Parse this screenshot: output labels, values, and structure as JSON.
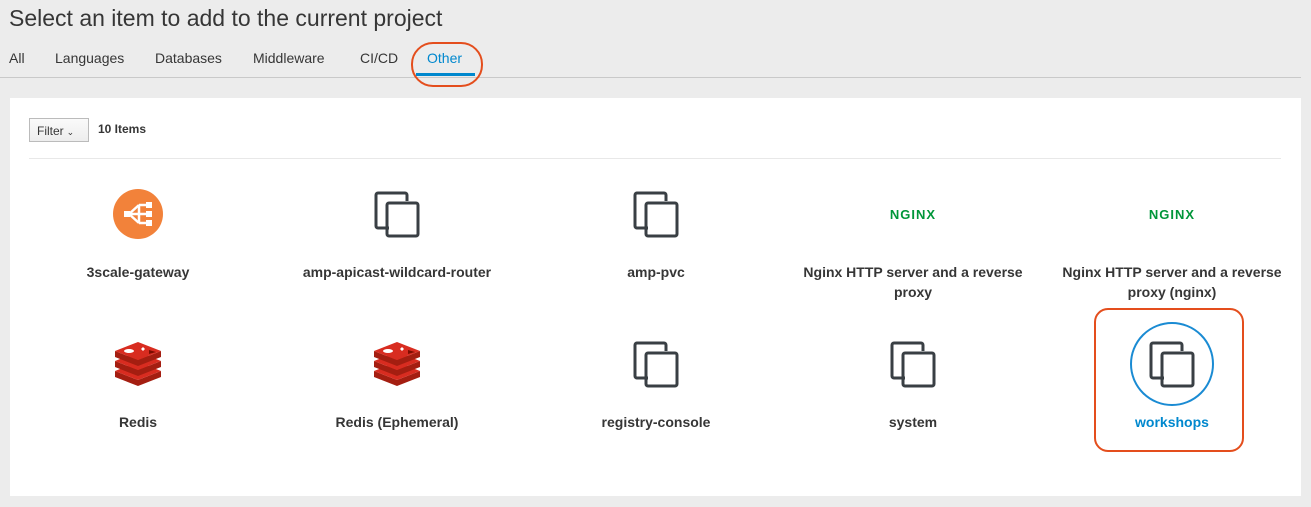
{
  "page": {
    "title": "Select an item to add to the current project"
  },
  "tabs": [
    {
      "label": "All"
    },
    {
      "label": "Languages"
    },
    {
      "label": "Databases"
    },
    {
      "label": "Middleware"
    },
    {
      "label": "CI/CD"
    },
    {
      "label": "Other"
    }
  ],
  "toolbar": {
    "filter_label": "Filter",
    "count": "10 Items"
  },
  "items": [
    {
      "label": "3scale-gateway",
      "icon": "3scale-gateway-icon"
    },
    {
      "label": "amp-apicast-wildcard-router",
      "icon": "template-icon"
    },
    {
      "label": "amp-pvc",
      "icon": "template-icon"
    },
    {
      "label": "Nginx HTTP server and a reverse proxy",
      "icon": "nginx-icon",
      "logo_text": "NGINX"
    },
    {
      "label": "Nginx HTTP server and a reverse proxy (nginx)",
      "icon": "nginx-icon",
      "logo_text": "NGINX"
    },
    {
      "label": "Redis",
      "icon": "redis-icon"
    },
    {
      "label": "Redis (Ephemeral)",
      "icon": "redis-icon"
    },
    {
      "label": "registry-console",
      "icon": "template-icon"
    },
    {
      "label": "system",
      "icon": "template-icon"
    },
    {
      "label": "workshops",
      "icon": "template-icon",
      "selected": true
    }
  ],
  "colors": {
    "accent": "#0088ce",
    "highlight_ring": "#e44e1d",
    "nginx_green": "#009639",
    "redis_red": "#d82c20",
    "gateway_orange": "#f2823a"
  }
}
